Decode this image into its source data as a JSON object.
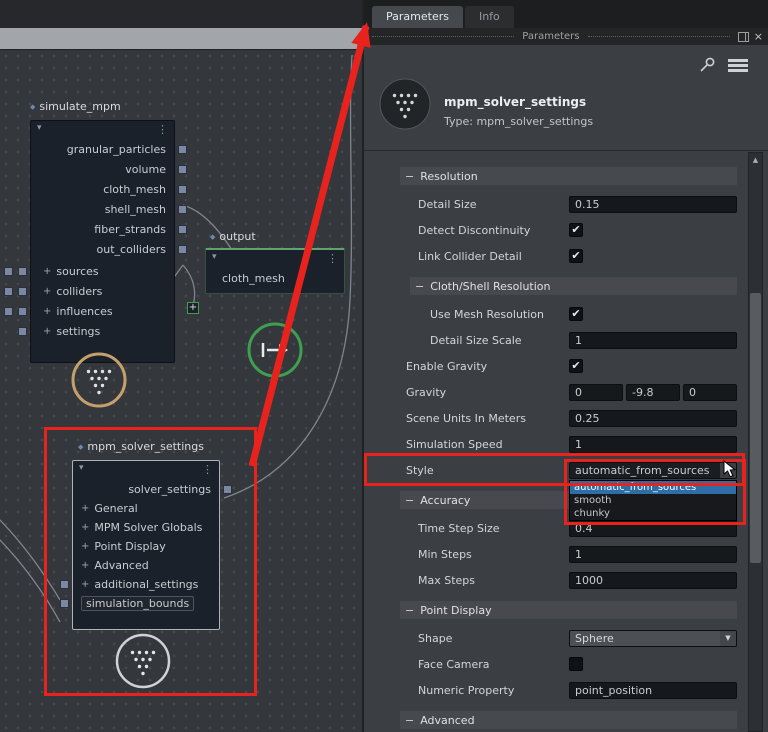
{
  "colors": {
    "annotation_red": "#e8231d",
    "selection_blue": "#2e6ea6",
    "accent_green": "#3f9e4f",
    "accent_tan": "#c6a06b",
    "graph_bg": "#34383d",
    "panel_bg": "#3b3e43",
    "field_bg": "#16191c"
  },
  "left": {
    "nodes": {
      "simulate": {
        "title": "simulate_mpm",
        "outputs": [
          "granular_particles",
          "volume",
          "cloth_mesh",
          "shell_mesh",
          "fiber_strands",
          "out_colliders"
        ],
        "inputs": [
          {
            "label": "sources",
            "plus": true
          },
          {
            "label": "colliders",
            "plus": true
          },
          {
            "label": "influences",
            "plus": true
          },
          {
            "label": "settings",
            "plus": true
          }
        ]
      },
      "output": {
        "title": "output",
        "row": "cloth_mesh"
      },
      "solver": {
        "title": "mpm_solver_settings",
        "header": "solver_settings",
        "items": [
          {
            "label": "General",
            "plus": true
          },
          {
            "label": "MPM Solver Globals",
            "plus": true
          },
          {
            "label": "Point Display",
            "plus": true
          },
          {
            "label": "Advanced",
            "plus": true
          },
          {
            "label": "additional_settings",
            "plus": true,
            "connector": true
          },
          {
            "label": "simulation_bounds",
            "plus": false,
            "badge": true,
            "connector": true
          }
        ]
      }
    }
  },
  "right": {
    "tabs": [
      {
        "label": "Parameters",
        "active": true
      },
      {
        "label": "Info",
        "active": false
      }
    ],
    "pane_label": "Parameters",
    "header": {
      "title": "mpm_solver_settings",
      "subtitle": "Type: mpm_solver_settings"
    },
    "params": [
      {
        "kind": "section",
        "label": "Resolution",
        "indent": 0
      },
      {
        "kind": "field",
        "label": "Detail Size",
        "value": "0.15",
        "indent": 1
      },
      {
        "kind": "check",
        "label": "Detect Discontinuity",
        "checked": true,
        "indent": 1
      },
      {
        "kind": "check",
        "label": "Link Collider Detail",
        "checked": true,
        "indent": 1
      },
      {
        "kind": "section",
        "label": "Cloth/Shell Resolution",
        "indent": 1
      },
      {
        "kind": "check",
        "label": "Use Mesh Resolution",
        "checked": true,
        "indent": 2
      },
      {
        "kind": "field",
        "label": "Detail Size Scale",
        "value": "1",
        "indent": 2
      },
      {
        "kind": "check",
        "label": "Enable Gravity",
        "checked": true,
        "indent": 0
      },
      {
        "kind": "vec3",
        "label": "Gravity",
        "values": [
          "0",
          "-9.8",
          "0"
        ],
        "indent": 0
      },
      {
        "kind": "field",
        "label": "Scene Units In Meters",
        "value": "0.25",
        "indent": 0
      },
      {
        "kind": "field",
        "label": "Simulation Speed",
        "value": "1",
        "indent": 0
      },
      {
        "kind": "dropdown",
        "label": "Style",
        "value": "automatic_from_sources",
        "variant": "dark",
        "id": "style",
        "indent": 0
      },
      {
        "kind": "section",
        "label": "Accuracy",
        "indent": 0
      },
      {
        "kind": "field",
        "label": "Time Step Size",
        "value": "0.4",
        "indent": 1
      },
      {
        "kind": "field",
        "label": "Min Steps",
        "value": "1",
        "indent": 1
      },
      {
        "kind": "field",
        "label": "Max Steps",
        "value": "1000",
        "indent": 1
      },
      {
        "kind": "section",
        "label": "Point Display",
        "indent": 0
      },
      {
        "kind": "dropdown",
        "label": "Shape",
        "value": "Sphere",
        "variant": "gray",
        "id": "shape",
        "indent": 1
      },
      {
        "kind": "check",
        "label": "Face Camera",
        "checked": false,
        "indent": 1
      },
      {
        "kind": "field",
        "label": "Numeric Property",
        "value": "point_position",
        "indent": 1
      },
      {
        "kind": "section",
        "label": "Advanced",
        "indent": 0
      }
    ],
    "style_dropdown": {
      "options": [
        "automatic_from_sources",
        "smooth",
        "chunky"
      ],
      "selected_index": 0
    }
  }
}
